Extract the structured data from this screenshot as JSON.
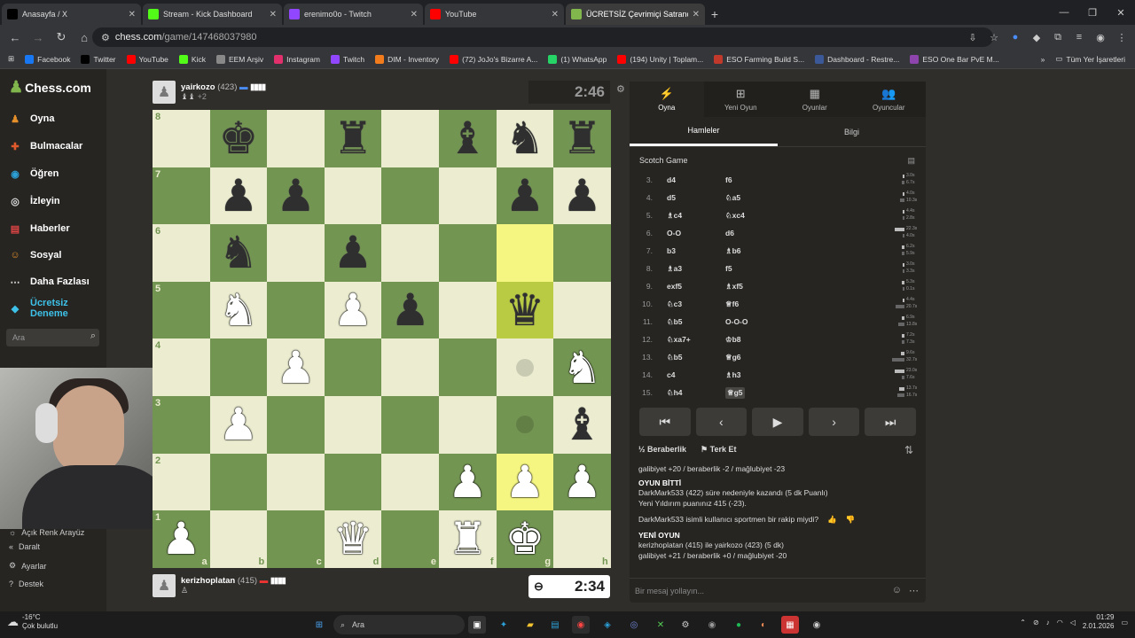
{
  "browser": {
    "tabs": [
      {
        "label": "Anasayfa / X",
        "icon": "x-icon",
        "color": "#000000"
      },
      {
        "label": "Stream - Kick Dashboard",
        "icon": "kick-icon",
        "color": "#53fc18"
      },
      {
        "label": "erenimo0o - Twitch",
        "icon": "twitch-icon",
        "color": "#9146ff"
      },
      {
        "label": "YouTube",
        "icon": "youtube-icon",
        "color": "#ff0000"
      },
      {
        "label": "ÜCRETSİZ Çevrimiçi Satranç Oy",
        "icon": "chess-icon",
        "color": "#81b64c"
      }
    ],
    "url_host": "chess.com",
    "url_path": "/game/147468037980",
    "bookmarks": [
      {
        "label": "Facebook",
        "color": "#1877f2"
      },
      {
        "label": "Twitter",
        "color": "#000000"
      },
      {
        "label": "YouTube",
        "color": "#ff0000"
      },
      {
        "label": "Kick",
        "color": "#53fc18"
      },
      {
        "label": "EEM Arşiv",
        "color": "#888888"
      },
      {
        "label": "Instagram",
        "color": "#e1306c"
      },
      {
        "label": "Twitch",
        "color": "#9146ff"
      },
      {
        "label": "DIM - Inventory",
        "color": "#f27b1c"
      },
      {
        "label": "(72) JoJo's Bizarre A...",
        "color": "#ff0000"
      },
      {
        "label": "(1) WhatsApp",
        "color": "#25d366"
      },
      {
        "label": "(194) Unity | Toplam...",
        "color": "#ff0000"
      },
      {
        "label": "ESO Farming Build S...",
        "color": "#c0392b"
      },
      {
        "label": "Dashboard - Restre...",
        "color": "#3b5998"
      },
      {
        "label": "ESO One Bar PvE M...",
        "color": "#8e44ad"
      }
    ],
    "all_bookmarks": "Tüm Yer İşaretleri"
  },
  "sidebar": {
    "logo": "Chess.com",
    "items": [
      {
        "label": "Oyna",
        "icon": "play-icon",
        "color": "#e58f2a"
      },
      {
        "label": "Bulmacalar",
        "icon": "puzzle-icon",
        "color": "#e05a2c"
      },
      {
        "label": "Öğren",
        "icon": "learn-icon",
        "color": "#2c9fd6"
      },
      {
        "label": "İzleyin",
        "icon": "watch-icon",
        "color": "#dddddd"
      },
      {
        "label": "Haberler",
        "icon": "news-icon",
        "color": "#dd4444"
      },
      {
        "label": "Sosyal",
        "icon": "social-icon",
        "color": "#e58f2a"
      },
      {
        "label": "Daha Fazlası",
        "icon": "more-icon",
        "color": "#dddddd"
      }
    ],
    "trial": "Ücretsiz Deneme",
    "search_placeholder": "Ara",
    "bottom": [
      {
        "label": "Açık Renk Arayüz"
      },
      {
        "label": "Daralt"
      },
      {
        "label": "Ayarlar"
      },
      {
        "label": "Destek"
      }
    ]
  },
  "game": {
    "top_player": {
      "name": "yairkozo",
      "rating": "(423)",
      "captured": "♝♝",
      "advantage": "+2",
      "clock": "2:46"
    },
    "bottom_player": {
      "name": "kerizhoplatan",
      "rating": "(415)",
      "clock": "2:34"
    },
    "board": [
      [
        "",
        "bk",
        "",
        "br",
        "",
        "bb",
        "bn",
        "br"
      ],
      [
        "",
        "bp",
        "bp",
        "",
        "",
        "",
        "bp",
        "bp"
      ],
      [
        "",
        "bn",
        "",
        "bp",
        "",
        "",
        "",
        ""
      ],
      [
        "",
        "wn",
        "",
        "wp",
        "bp",
        "",
        "bq",
        ""
      ],
      [
        "",
        "",
        "wp",
        "",
        "",
        "",
        "",
        "wn"
      ],
      [
        "",
        "wp",
        "",
        "",
        "",
        "",
        "",
        "bb"
      ],
      [
        "",
        "",
        "",
        "",
        "",
        "wp",
        "wp",
        "wp"
      ],
      [
        "wp",
        "",
        "",
        "wq",
        "",
        "wr",
        "wk",
        ""
      ]
    ],
    "highlight": [
      "6-6",
      "3-6",
      "6-6"
    ],
    "ranks": [
      "8",
      "7",
      "6",
      "5",
      "4",
      "3",
      "2",
      "1"
    ],
    "files": [
      "a",
      "b",
      "c",
      "d",
      "e",
      "f",
      "g",
      "h"
    ]
  },
  "panel": {
    "tabs": [
      {
        "label": "Oyna",
        "icon": "bolt-icon"
      },
      {
        "label": "Yeni Oyun",
        "icon": "plus-icon"
      },
      {
        "label": "Oyunlar",
        "icon": "games-icon"
      },
      {
        "label": "Oyuncular",
        "icon": "players-icon"
      }
    ],
    "subtabs": [
      "Hamleler",
      "Bilgi"
    ],
    "opening": "Scotch Game",
    "moves": [
      {
        "n": "3.",
        "w": "d4",
        "b": "f6",
        "t1": "3.0s",
        "t2": "6.7s",
        "f1": 0.1,
        "f2": 0.2
      },
      {
        "n": "4.",
        "w": "d5",
        "b": "♘a5",
        "t1": "4.0s",
        "t2": "10.3s",
        "f1": 0.15,
        "f2": 0.35
      },
      {
        "n": "5.",
        "w": "♗c4",
        "b": "♘xc4",
        "t1": "4.4s",
        "t2": "2.8s",
        "f1": 0.15,
        "f2": 0.1
      },
      {
        "n": "6.",
        "w": "O-O",
        "b": "d6",
        "t1": "22.3s",
        "t2": "4.0s",
        "f1": 0.8,
        "f2": 0.15
      },
      {
        "n": "7.",
        "w": "b3",
        "b": "♗b6",
        "t1": "6.2s",
        "t2": "5.9s",
        "f1": 0.2,
        "f2": 0.2
      },
      {
        "n": "8.",
        "w": "♗a3",
        "b": "f5",
        "t1": "3.0s",
        "t2": "3.3s",
        "f1": 0.1,
        "f2": 0.1
      },
      {
        "n": "9.",
        "w": "exf5",
        "b": "♗xf5",
        "t1": "5.3s",
        "t2": "0.1s",
        "f1": 0.2,
        "f2": 0.02
      },
      {
        "n": "10.",
        "w": "♘c3",
        "b": "♕f6",
        "t1": "4.4s",
        "t2": "20.7s",
        "f1": 0.15,
        "f2": 0.7
      },
      {
        "n": "11.",
        "w": "♘b5",
        "b": "O-O-O",
        "t1": "6.9s",
        "t2": "13.8s",
        "f1": 0.25,
        "f2": 0.5
      },
      {
        "n": "12.",
        "w": "♘xa7+",
        "b": "♔b8",
        "t1": "7.2s",
        "t2": "7.3s",
        "f1": 0.25,
        "f2": 0.25
      },
      {
        "n": "13.",
        "w": "♘b5",
        "b": "♕g6",
        "t1": "9.6s",
        "t2": "32.7s",
        "f1": 0.3,
        "f2": 1.0
      },
      {
        "n": "14.",
        "w": "c4",
        "b": "♗h3",
        "t1": "23.0s",
        "t2": "7.6s",
        "f1": 0.8,
        "f2": 0.25
      },
      {
        "n": "15.",
        "w": "♘h4",
        "b": "♕g5",
        "t1": "13.7s",
        "t2": "16.7s",
        "f1": 0.45,
        "f2": 0.55
      }
    ],
    "actions": {
      "draw": "Beraberlik",
      "resign": "Terk Et"
    },
    "chat": {
      "l1": "galibiyet +20 / beraberlik -2 / mağlubiyet -23",
      "l2": "OYUN BİTTİ",
      "l3": "DarkMark533 (422) süre nedeniyle kazandı (5 dk Puanlı)",
      "l4": "Yeni Yıldırım puanınız 415 (-23).",
      "l5": "DarkMark533 isimli kullanıcı sportmen bir rakip miydi?",
      "l6": "YENİ OYUN",
      "l7": "kerizhoplatan (415) ile yairkozo (423) (5 dk)",
      "l8": "galibiyet +21 / beraberlik +0 / mağlubiyet -20"
    },
    "chat_placeholder": "Bir mesaj yollayın..."
  },
  "taskbar": {
    "temp": "-16°C",
    "weather": "Çok bulutlu",
    "search": "Ara",
    "time": "01:29",
    "date": "2.01.2026"
  }
}
